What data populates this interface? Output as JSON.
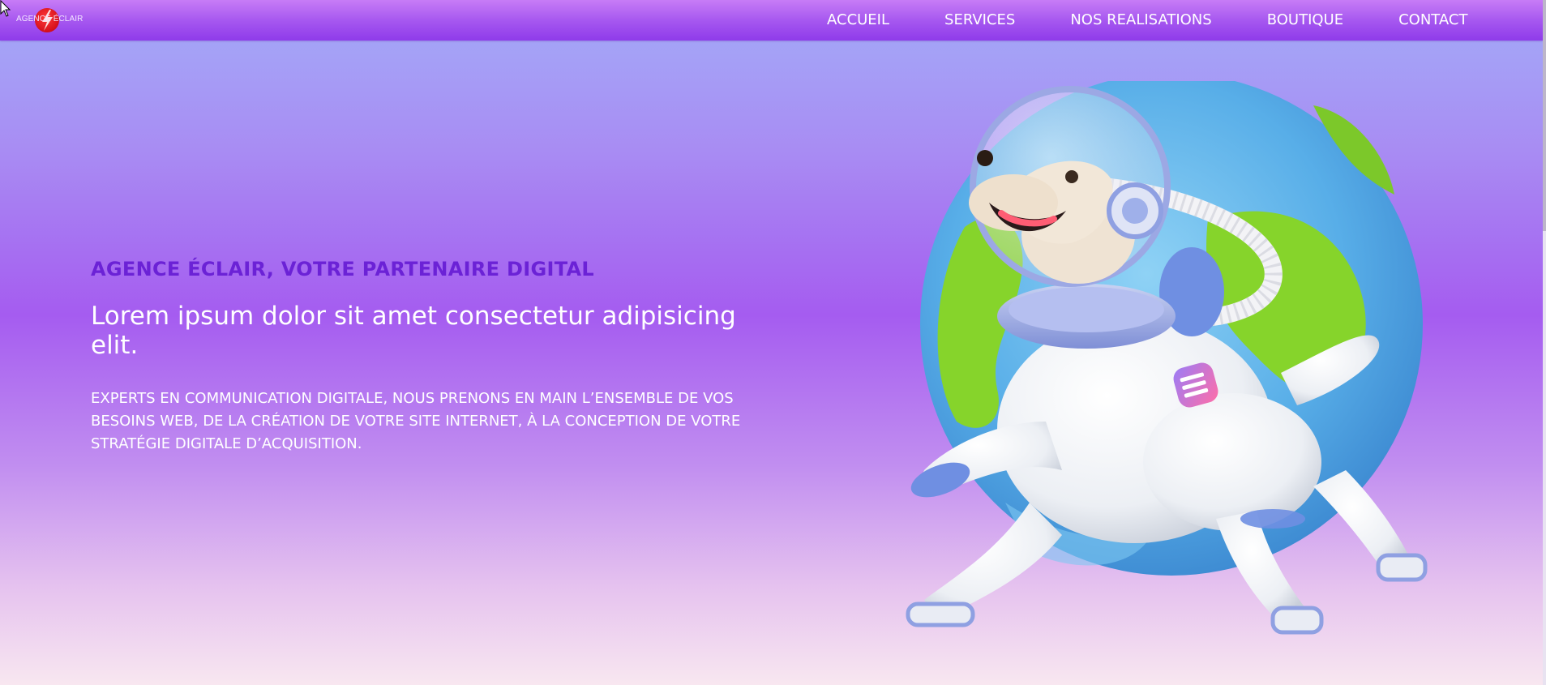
{
  "brand": {
    "logo_text": "AGENCE ÉCLAIR"
  },
  "nav": {
    "items": [
      {
        "label": "ACCUEIL"
      },
      {
        "label": "SERVICES"
      },
      {
        "label": "NOS REALISATIONS"
      },
      {
        "label": "BOUTIQUE"
      },
      {
        "label": "CONTACT"
      }
    ]
  },
  "hero": {
    "kicker": "AGENCE ÉCLAIR, VOTRE PARTENAIRE DIGITAL",
    "headline": "Lorem ipsum dolor sit amet consectetur adipisicing elit.",
    "description": "EXPERTS EN COMMUNICATION DIGITALE, NOUS PRENONS EN MAIN L’ENSEMBLE DE VOS BESOINS WEB, DE LA CRÉATION DE VOTRE SITE INTERNET, À LA CONCEPTION DE VOTRE STRATÉGIE DIGITALE D’ACQUISITION."
  },
  "illustration": {
    "icon": "astronaut-dog-globe-illustration"
  },
  "colors": {
    "header": "#9b4cee",
    "kicker": "#6b22d6",
    "background_top": "#a3acf8",
    "background_mid": "#a55cf0",
    "background_bottom": "#f8e7f0",
    "logo_red": "#d50f1a"
  }
}
